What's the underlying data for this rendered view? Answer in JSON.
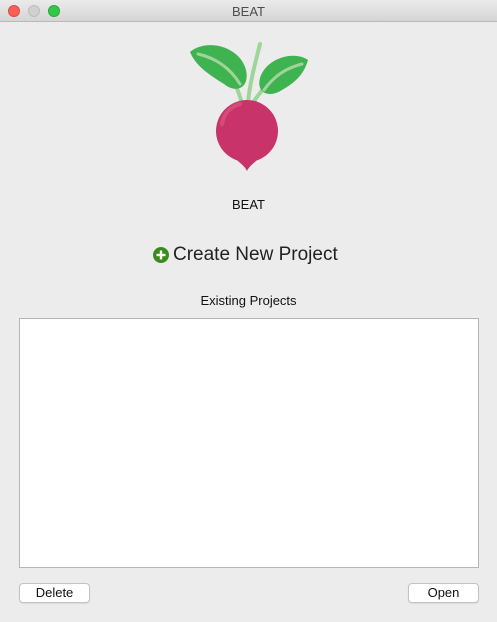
{
  "window": {
    "title": "BEAT"
  },
  "app": {
    "name": "BEAT",
    "logo_icon": "beetroot-logo-icon"
  },
  "create": {
    "label": "Create New Project",
    "icon": "plus-circle-icon",
    "icon_color": "#3b8a1f"
  },
  "existing": {
    "label": "Existing Projects",
    "items": []
  },
  "buttons": {
    "delete": "Delete",
    "open": "Open"
  },
  "colors": {
    "beet": "#c8336a",
    "leaf": "#3fb34f",
    "stem": "#9fd59a"
  }
}
